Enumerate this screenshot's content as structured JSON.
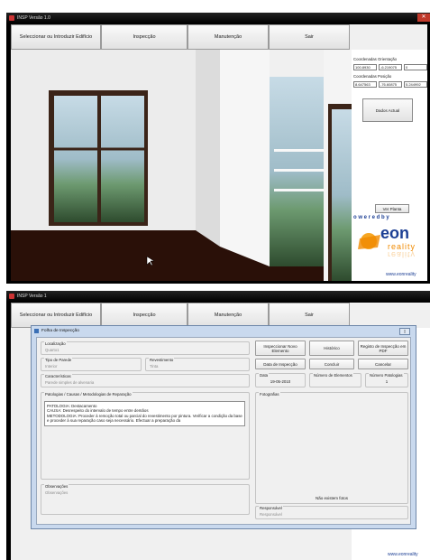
{
  "window_title": "INSP Versão 1.0",
  "window_title_lower": "INSP Versão 1",
  "menu": {
    "select_building": "Seleccionar ou Introduzir Edifício",
    "inspection": "Inspecção",
    "maintenance": "Manutenção",
    "exit": "Sair"
  },
  "right_panel": {
    "orientation_label": "Coordenadas Orientação",
    "orientation_values": [
      "100.8930",
      "-6.219075",
      "0"
    ],
    "position_label": "Coordenadas Posição",
    "position_values": [
      "8.647563",
      "-76.60875",
      "5.244992"
    ],
    "update_button": "Dados Actual",
    "floor_plan_button": "Ver Planta",
    "powered_by": "o w e r e d   b y",
    "logo_text_eon": "eon",
    "logo_text_reality": "reality",
    "url": "www.eonreality"
  },
  "dialog": {
    "title": "Folha de Inspecção",
    "location_label": "Localização",
    "location_value": "Quarto1",
    "wall_type_label": "Tipo de Parede",
    "wall_type_value": "Interior",
    "covering_label": "Revestimento",
    "covering_value": "Tinta",
    "characteristics_label": "Características",
    "characteristics_value": "Parede simples de alvenaria",
    "pathologies_label": "Patologias / Causas / Metodologias de Reparação",
    "pathology_text": [
      "PATOLOGIA: Destacamento",
      "CAUSA: Desrespeito do intervalo de tempo entre demãos",
      "METODOLOGIA: Proceder à remoção total ou parcial do revestimento por pintura. Verificar a condição da base e proceder à sua reparação caso seja necessário. Efectuar a preparação da"
    ],
    "observations_label": "Observações",
    "observations_value": "Observações",
    "buttons": {
      "new_element": "Inspeccionar Novo Elemento",
      "history": "Histórico",
      "pdf": "Registo de Inspecção em PDF",
      "inspection_date": "Data de Inspecção",
      "conclude": "Concluir",
      "cancel": "Cancelar"
    },
    "date_label": "Data",
    "date_value": "19-05-2010",
    "elements_label": "Número de Elementos",
    "pathology_count_label": "Número Patologias",
    "pathology_count_value": "1",
    "photos_label": "Fotografias",
    "no_photos": "Não existem fotos",
    "responsible_label": "Responsável",
    "responsible_value": "Responsável"
  },
  "colors": {
    "accent_orange": "#f08a00",
    "logo_blue": "#1c3f94"
  }
}
